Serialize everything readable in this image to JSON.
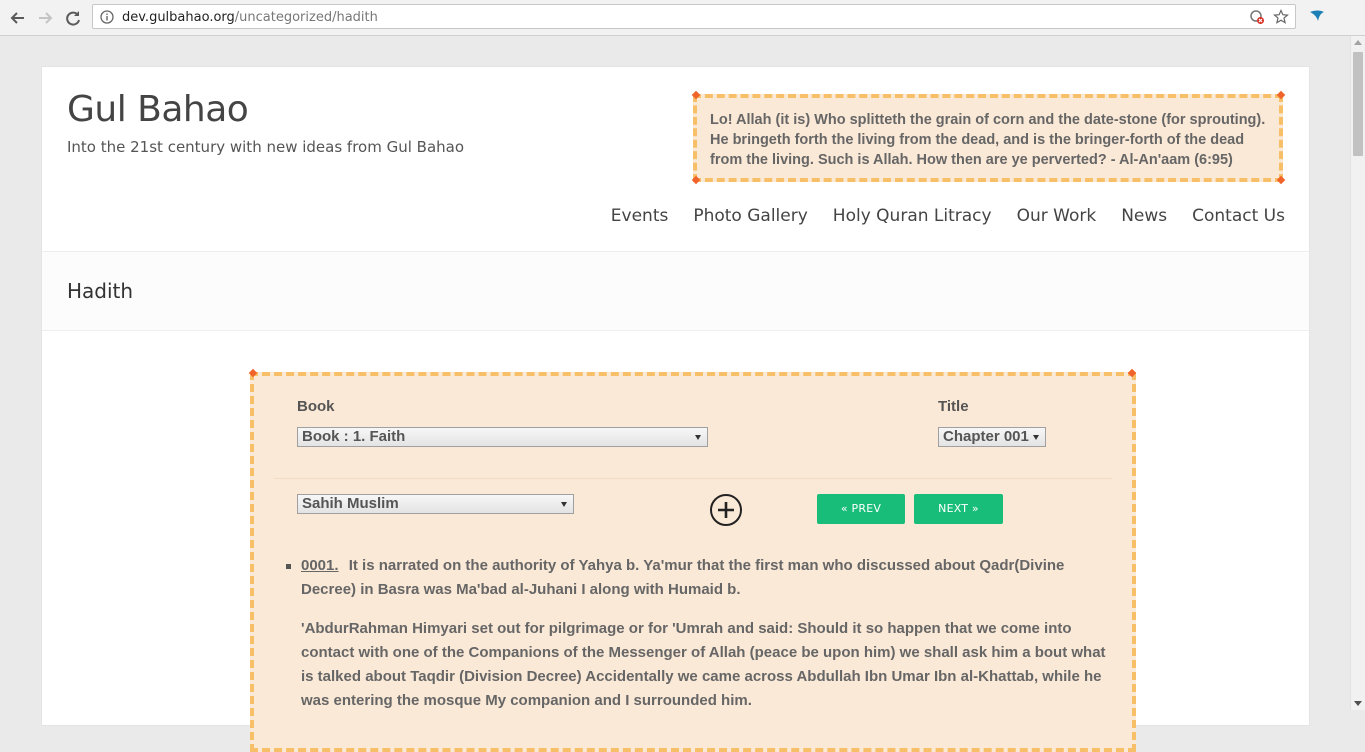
{
  "browser": {
    "url_host": "dev.gulbahao.org",
    "url_path": "/uncategorized/hadith"
  },
  "site": {
    "title": "Gul Bahao",
    "tagline": "Into the 21st century with new ideas from Gul Bahao",
    "quote": "Lo! Allah (it is) Who splitteth the grain of corn and the date-stone (for sprouting). He bringeth forth the living from the dead, and is the bringer-forth of the dead from the living. Such is Allah. How then are ye perverted? - Al-An'aam (6:95)"
  },
  "nav": {
    "items": [
      "Events",
      "Photo Gallery",
      "Holy Quran Litracy",
      "Our Work",
      "News",
      "Contact Us"
    ]
  },
  "page": {
    "title": "Hadith"
  },
  "panel": {
    "book_label": "Book",
    "book_value": "Book : 1. Faith",
    "title_label": "Title",
    "title_value": "Chapter 001",
    "collection_value": "Sahih Muslim",
    "prev_label": "« PREV",
    "next_label": "NEXT »"
  },
  "hadith": {
    "number": "0001.",
    "text1": "It is narrated on the authority of Yahya b. Ya'mur that the first man who discussed about Qadr(Divine Decree) in Basra was Ma'bad al-Juhani I along with Humaid b.",
    "text2": "'AbdurRahman Himyari set out for pilgrimage or for 'Umrah and said: Should it so happen that we come into contact with one of the Companions of the Messenger of Allah (peace be upon him) we shall ask him a bout what is talked about Taqdir (Division Decree) Accidentally we came across Abdullah Ibn Umar Ibn al-Khattab, while he was entering the mosque My companion and I surrounded him."
  },
  "colors": {
    "accent_green": "#19bd7a",
    "panel_bg": "#fbe9d7",
    "panel_border": "#f7c068",
    "corner": "#f0632a"
  }
}
